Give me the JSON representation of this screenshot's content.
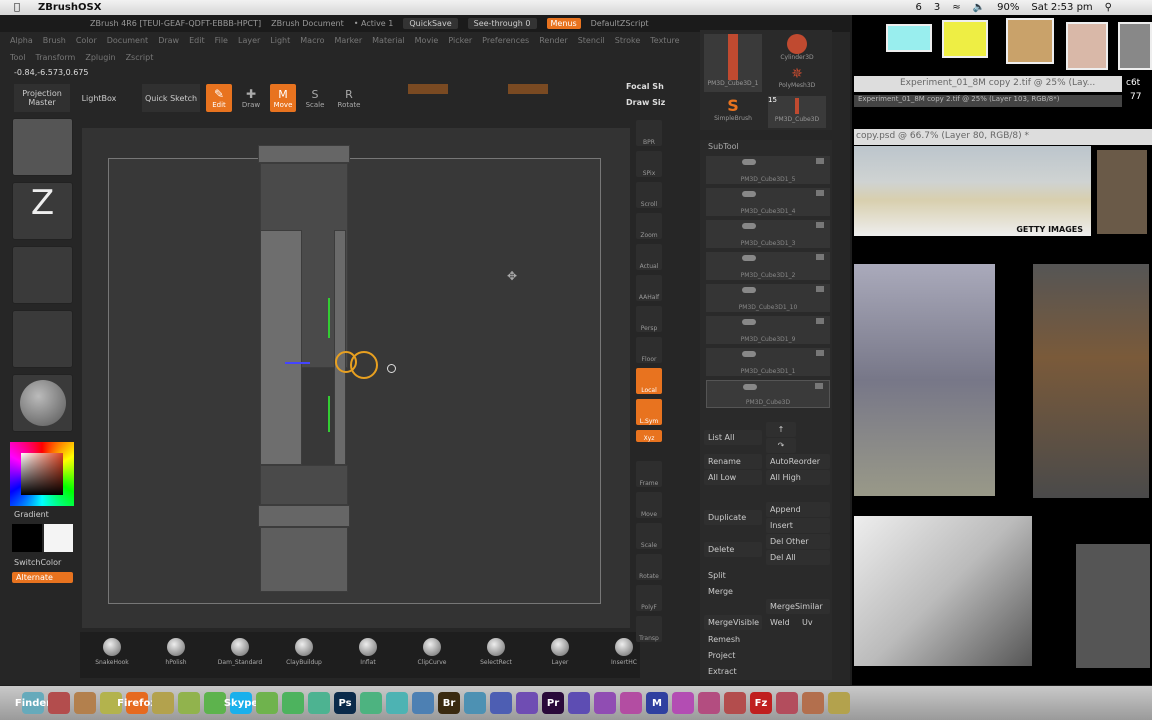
{
  "macbar": {
    "app_name": "ZBrushOSX",
    "status_items": [
      "6",
      "3",
      "90%",
      "Sat 2:53 pm"
    ]
  },
  "titlebar": {
    "title": "ZBrush 4R6 [TEUI-GEAF-QDFT-EBBB-HPCT]",
    "document": "ZBrush Document",
    "active": "• Active 1",
    "quicksave": "QuickSave",
    "seethrough": "See-through  0",
    "menus": "Menus",
    "script": "DefaultZScript"
  },
  "menus": [
    "Alpha",
    "Brush",
    "Color",
    "Document",
    "Draw",
    "Edit",
    "File",
    "Layer",
    "Light",
    "Macro",
    "Marker",
    "Material",
    "Movie",
    "Picker",
    "Preferences",
    "Render",
    "Stencil",
    "Stroke",
    "Texture"
  ],
  "menus2": [
    "Tool",
    "Transform",
    "Zplugin",
    "Zscript"
  ],
  "coord": "-0.84,-6.573,0.675",
  "toolbar": {
    "projection_master": "Projection Master",
    "lightbox": "LightBox",
    "quick_sketch": "Quick Sketch",
    "edit": "Edit",
    "draw": "Draw",
    "move": "Move",
    "scale": "Scale",
    "rotate": "Rotate",
    "focal": "Focal Sh",
    "draw_size": "Draw Siz"
  },
  "left_shelf": {
    "gradient": "Gradient",
    "switch_color": "SwitchColor",
    "alternate": "Alternate"
  },
  "right_shelf": [
    "BPR",
    "SPix",
    "Scroll",
    "Zoom",
    "Actual",
    "AAHalf",
    "Persp",
    "Floor",
    "Local",
    "L.Sym",
    "Xyz",
    "Frame",
    "Move",
    "Scale",
    "Rotate",
    "PolyF",
    "Transp"
  ],
  "tool_palette": {
    "items": [
      "PM3D_Cube3D_1",
      "Cylinder3D",
      "PolyMesh3D",
      "SimpleBrush",
      "PM3D_Cube3D"
    ],
    "count": "15"
  },
  "subtool": {
    "title": "SubTool",
    "items": [
      "PM3D_Cube3D1_5",
      "PM3D_Cube3D1_4",
      "PM3D_Cube3D1_3",
      "PM3D_Cube3D1_2",
      "PM3D_Cube3D1_10",
      "PM3D_Cube3D1_9",
      "PM3D_Cube3D1_1",
      "PM3D_Cube3D"
    ],
    "buttons": {
      "list_all": "List All",
      "rename": "Rename",
      "autoreorder": "AutoReorder",
      "all_low": "All Low",
      "all_high": "All High",
      "duplicate": "Duplicate",
      "append": "Append",
      "insert": "Insert",
      "delete": "Delete",
      "del_other": "Del Other",
      "del_all": "Del All",
      "split": "Split",
      "merge": "Merge",
      "merge_similar": "MergeSimilar",
      "merge_visible": "MergeVisible",
      "weld": "Weld",
      "uv": "Uv",
      "remesh": "Remesh",
      "project": "Project",
      "extract": "Extract"
    }
  },
  "brushes": [
    "SnakeHook",
    "hPolish",
    "Dam_Standard",
    "ClayBuildup",
    "Inflat",
    "ClipCurve",
    "SelectRect",
    "Layer",
    "InsertHC"
  ],
  "photoshop": {
    "window1": "Experiment_01_8M copy 2.tif @ 25% (Lay...",
    "window1_tab": "Experiment_01_8M copy 2.tif @ 25% (Layer 103, RGB/8*)",
    "window2": "copy.psd @ 66.7% (Layer 80, RGB/8) *",
    "getty": "GETTY IMAGES",
    "side1": "c6t",
    "side2": "77"
  },
  "dock": [
    "Finder",
    "Firefox",
    "Skype",
    "Ps",
    "Br",
    "Pr",
    "M",
    "Fz"
  ],
  "colors": {
    "accent": "#e8731f",
    "panel": "#262626",
    "canvas": "#383838"
  }
}
